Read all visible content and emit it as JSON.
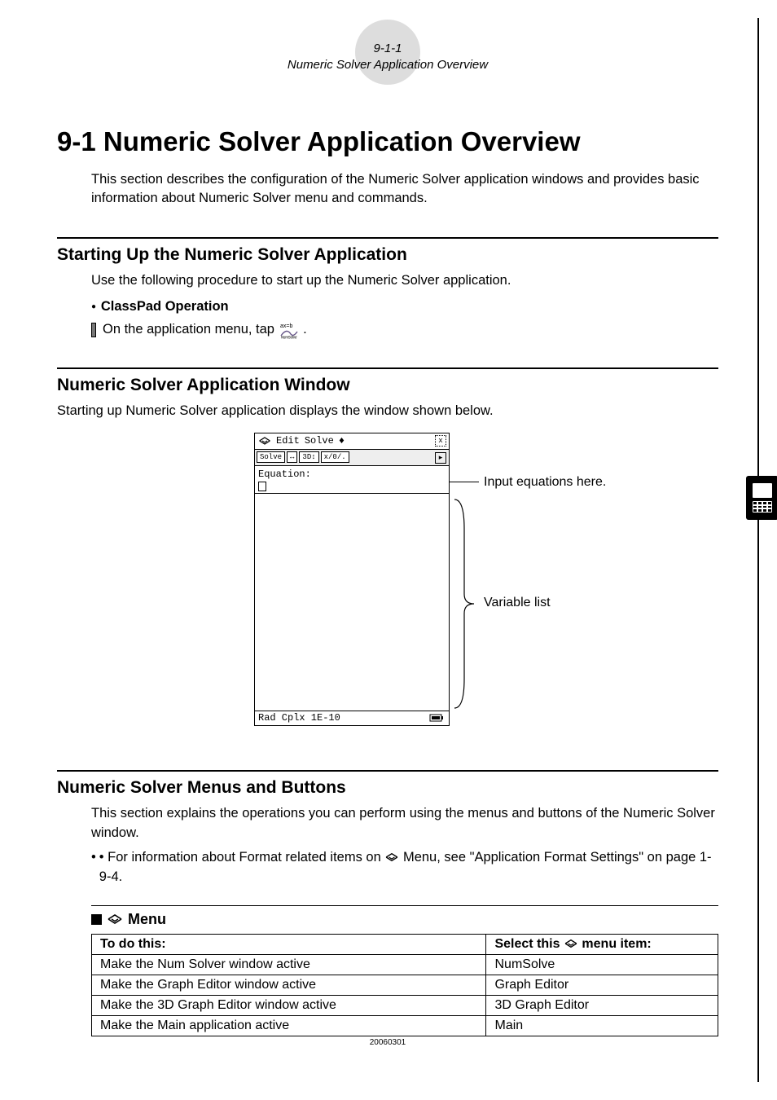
{
  "header": {
    "page_ref": "9-1-1",
    "title_small": "Numeric Solver Application Overview"
  },
  "title": "9-1 Numeric Solver Application Overview",
  "intro": "This section describes the configuration of the Numeric Solver application windows and provides basic information about Numeric Solver menu and commands.",
  "section_start": {
    "heading": "Starting Up the Numeric Solver Application",
    "body": "Use the following procedure to start up the Numeric Solver application.",
    "bullet": "ClassPad Operation",
    "step_prefix": "On the application menu, tap ",
    "step_suffix": "."
  },
  "section_window": {
    "heading": "Numeric Solver Application Window",
    "body": "Starting up Numeric Solver application displays the window shown below.",
    "callout_eq": "Input equations here.",
    "callout_var": "Variable list",
    "mock": {
      "menu_items": [
        "Edit",
        "Solve",
        "♦"
      ],
      "toolbar_items": [
        "Solve",
        "↔",
        "3D↕",
        "x/0/."
      ],
      "eq_label": "Equation:",
      "status_left": "Rad  Cplx 1E-10",
      "close": "x",
      "arrow": "▸"
    }
  },
  "section_menus": {
    "heading": "Numeric Solver Menus and Buttons",
    "body": "This section explains the operations you can perform using the menus and buttons of the Numeric Solver window.",
    "note": "For information about Format related items on  Menu, see \"Application Format Settings\" on page 1-9-4.",
    "note_prefix": "• For information about Format related items on ",
    "note_mid": " Menu, see \"Application Format Settings\" on page 1-9-4."
  },
  "menu_block": {
    "label": "Menu",
    "col_left": "To do this:",
    "col_right_prefix": "Select this ",
    "col_right_suffix": " menu item:",
    "rows": [
      {
        "left": "Make the Num Solver window active",
        "right": "NumSolve"
      },
      {
        "left": "Make the Graph Editor window active",
        "right": "Graph Editor"
      },
      {
        "left": "Make the 3D Graph Editor window active",
        "right": "3D Graph Editor"
      },
      {
        "left": "Make the Main application active",
        "right": "Main"
      }
    ]
  },
  "footer_date": "20060301"
}
